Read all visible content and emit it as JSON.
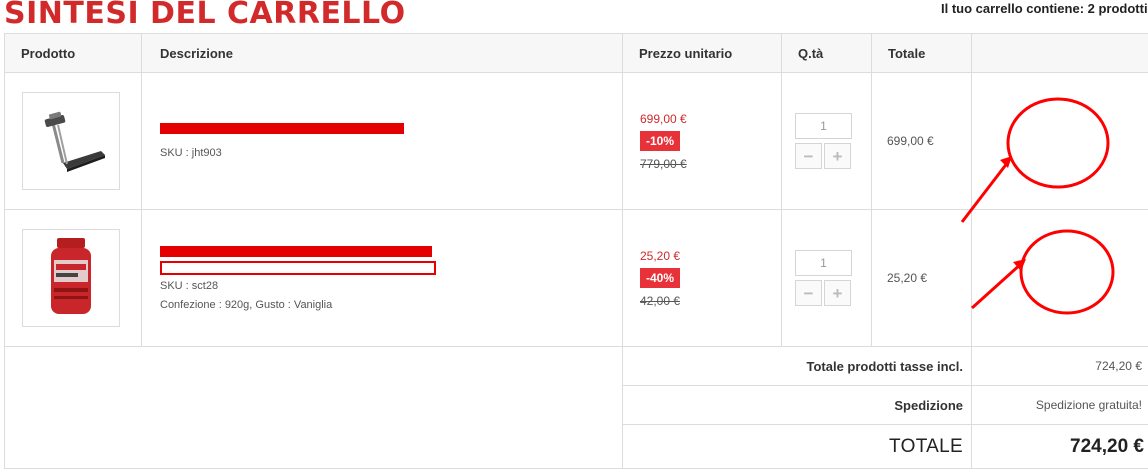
{
  "page": {
    "title": "SINTESI DEL CARRELLO",
    "cart_count": "Il tuo carrello contiene: 2 prodotti"
  },
  "table": {
    "headers": {
      "product": "Prodotto",
      "description": "Descrizione",
      "unit_price": "Prezzo unitario",
      "qty": "Q.tà",
      "total": "Totale"
    },
    "items": [
      {
        "name": "",
        "sku": "SKU : jht903",
        "options": "",
        "price": "699,00 €",
        "discount": "-10%",
        "old_price": "779,00 €",
        "qty": "1",
        "total": "699,00 €",
        "image": "treadmill"
      },
      {
        "name": "",
        "sku": "SKU : sct28",
        "options": "Confezione : 920g, Gusto : Vaniglia",
        "price": "25,20 €",
        "discount": "-40%",
        "old_price": "42,00 €",
        "qty": "1",
        "total": "25,20 €",
        "image": "protein-jar"
      }
    ],
    "qty_minus": "−",
    "qty_plus": "+"
  },
  "summary": {
    "products_label": "Totale prodotti tasse incl.",
    "products_value": "724,20 €",
    "shipping_label": "Spedizione",
    "shipping_value": "Spedizione gratuita!",
    "total_label": "TOTALE",
    "total_value": "724,20 €"
  },
  "colors": {
    "accent_red": "#d22a2a",
    "badge_red": "#e8323a",
    "annotation_red": "#ff0000"
  }
}
